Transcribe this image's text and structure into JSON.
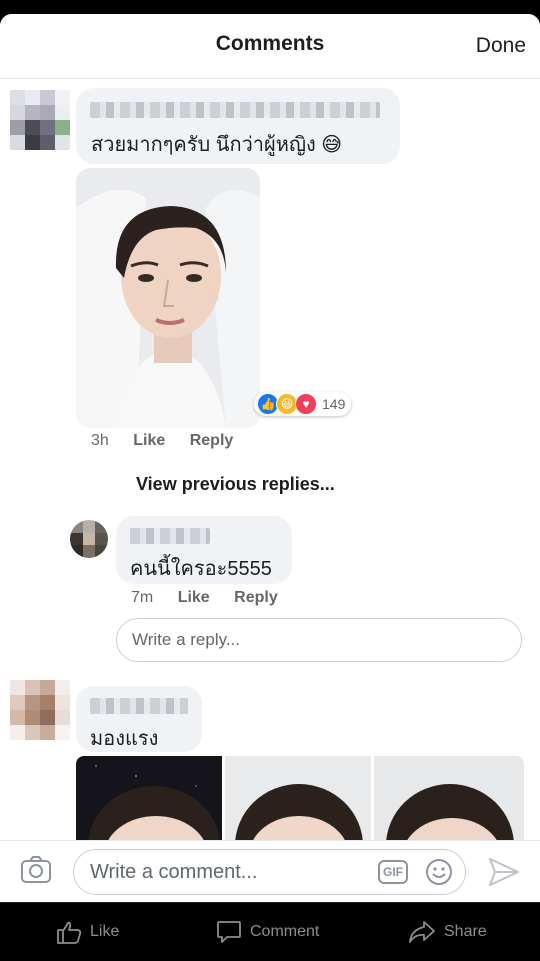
{
  "header": {
    "title": "Comments",
    "done_label": "Done"
  },
  "comments": [
    {
      "text": "สวยมากๆครับ นึกว่าผู้หญิง 😅",
      "reactions_count": "149",
      "time": "3h",
      "like_label": "Like",
      "reply_label": "Reply"
    },
    {
      "text": "มองแรง"
    }
  ],
  "view_previous": "View previous replies...",
  "reply": {
    "text": "คนนี้ใครอะ5555",
    "time": "7m",
    "like_label": "Like",
    "reply_label": "Reply"
  },
  "reply_input": {
    "placeholder": "Write a reply..."
  },
  "composer": {
    "placeholder": "Write a comment...",
    "gif_label": "GIF"
  },
  "tabbar": [
    {
      "label": "Like",
      "icon": "thumbs-up-icon"
    },
    {
      "label": "Comment",
      "icon": "comment-icon"
    },
    {
      "label": "Share",
      "icon": "share-icon"
    }
  ],
  "colors": {
    "like_blue": "#1877f2",
    "love_red": "#f33e58",
    "haha_yellow": "#f7b928"
  }
}
